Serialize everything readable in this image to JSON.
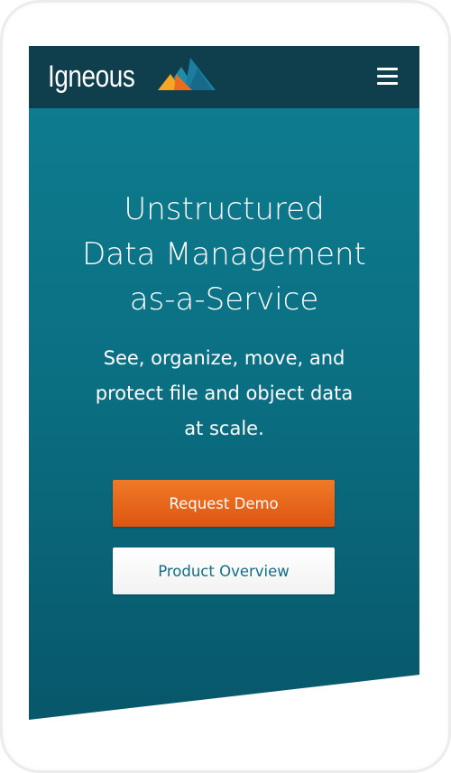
{
  "header": {
    "logo_text": "Igneous",
    "logo_mark": "igneous-mountain-mark",
    "menu_icon": "hamburger-menu-icon"
  },
  "hero": {
    "headline_lines": [
      "Unstructured",
      "Data Management",
      "as-a-Service"
    ],
    "subhead_lines": [
      "See, organize, move, and",
      "protect file and object data",
      "at scale."
    ],
    "primary_button_label": "Request Demo",
    "secondary_button_label": "Product Overview"
  },
  "colors": {
    "header_bg": "#0f3f4d",
    "hero_bg_top": "#0e7b8e",
    "hero_bg_bottom": "#08576a",
    "accent_orange": "#e5631a",
    "secondary_text": "#0f6f85"
  }
}
